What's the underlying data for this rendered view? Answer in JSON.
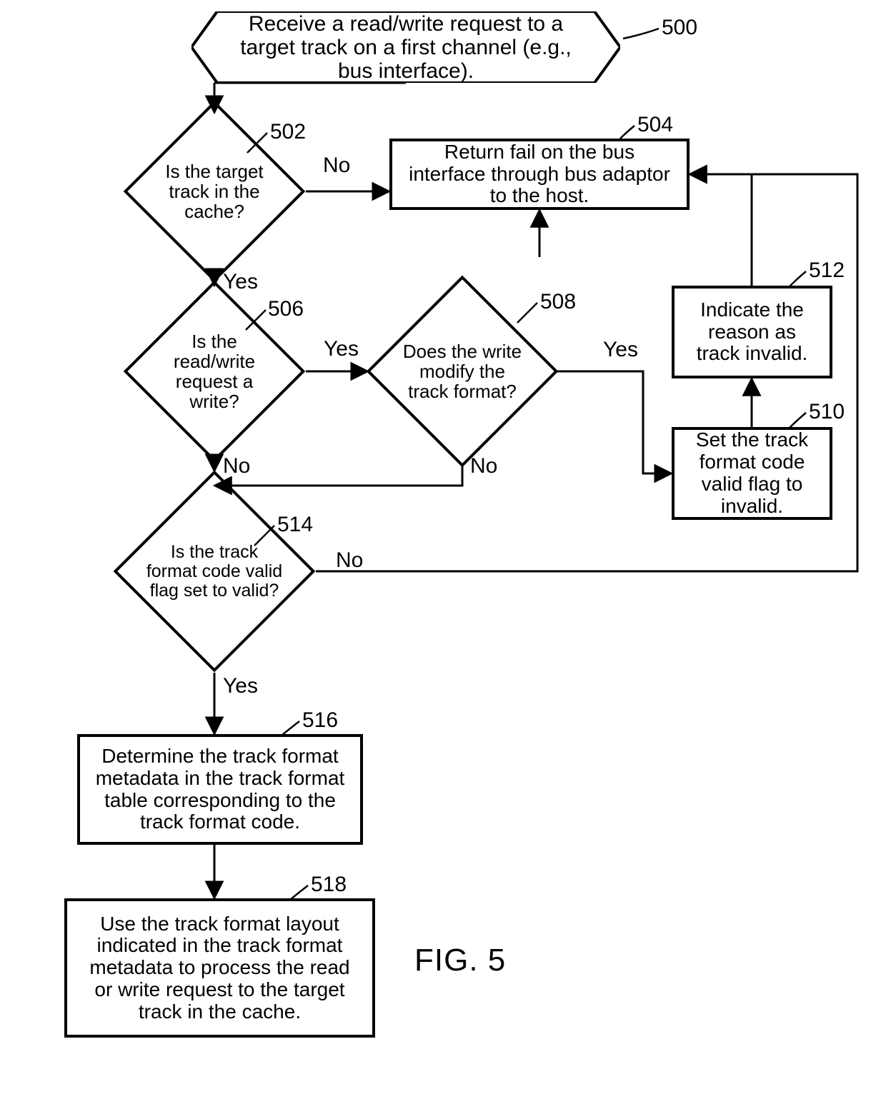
{
  "figure_label": "FIG. 5",
  "nodes": {
    "n500": "Receive a read/write request to a target track on a first channel (e.g., bus interface).",
    "n502": "Is the target track in the cache?",
    "n504": "Return fail on the bus interface through bus adaptor to the host.",
    "n506": "Is the read/write request a write?",
    "n508": "Does the write modify the track format?",
    "n510": "Set the track format code valid flag to invalid.",
    "n512": "Indicate the reason as track invalid.",
    "n514": "Is the track format code valid flag set to valid?",
    "n516": "Determine the track format metadata in the track format table corresponding to the track format code.",
    "n518": "Use the track format layout indicated in the track format metadata to process the read or write request to the target track in the cache."
  },
  "refs": {
    "r500": "500",
    "r502": "502",
    "r504": "504",
    "r506": "506",
    "r508": "508",
    "r510": "510",
    "r512": "512",
    "r514": "514",
    "r516": "516",
    "r518": "518"
  },
  "labels": {
    "yes": "Yes",
    "no": "No"
  }
}
